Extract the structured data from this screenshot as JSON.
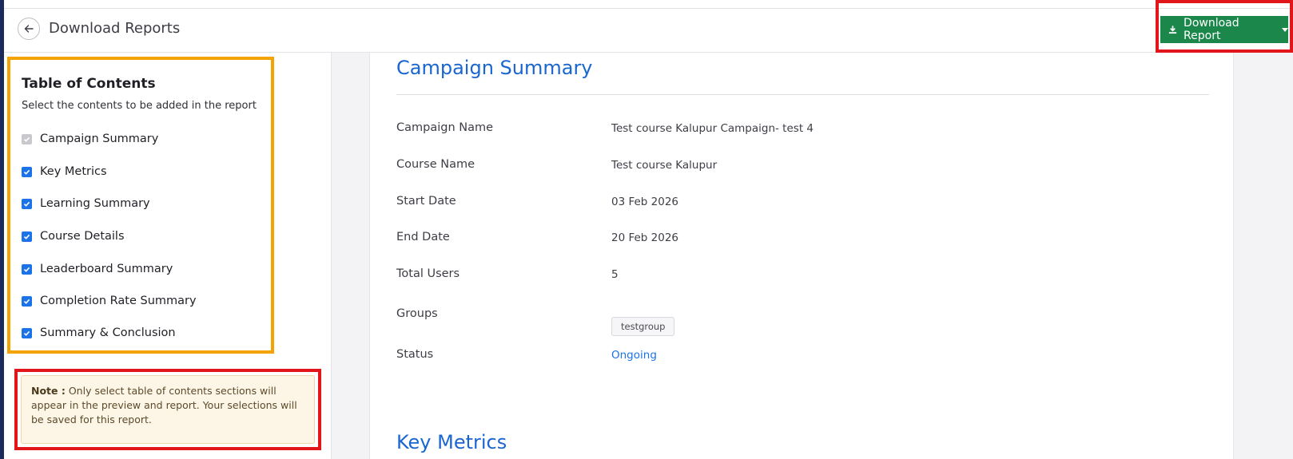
{
  "header": {
    "title": "Download Reports",
    "download_button": "Download Report"
  },
  "toc": {
    "title": "Table of Contents",
    "subtitle": "Select the contents to be added in the report",
    "items": [
      {
        "label": "Campaign Summary",
        "checked": true,
        "disabled": true
      },
      {
        "label": "Key Metrics",
        "checked": true
      },
      {
        "label": "Learning Summary",
        "checked": true
      },
      {
        "label": "Course Details",
        "checked": true
      },
      {
        "label": "Leaderboard Summary",
        "checked": true
      },
      {
        "label": "Completion Rate Summary",
        "checked": true
      },
      {
        "label": "Summary & Conclusion",
        "checked": true
      }
    ]
  },
  "note": {
    "label": "Note :",
    "text": " Only select table of contents sections will appear in the preview and report. Your selections will be saved for this report."
  },
  "summary": {
    "title": "Campaign Summary",
    "rows": [
      {
        "label": "Campaign Name",
        "value": "Test course Kalupur Campaign- test 4"
      },
      {
        "label": "Course Name",
        "value": "Test course Kalupur"
      },
      {
        "label": "Start Date",
        "value": "03 Feb 2026"
      },
      {
        "label": "End Date",
        "value": "20 Feb 2026"
      },
      {
        "label": "Total Users",
        "value": "5"
      },
      {
        "label": "Groups",
        "value": "testgroup"
      },
      {
        "label": "Status",
        "value": "Ongoing"
      }
    ],
    "next_section_title": "Key Metrics"
  },
  "colors": {
    "accent_blue": "#1a66d0",
    "download_green": "#1c874b",
    "highlight_red": "#e2151b",
    "highlight_orange": "#f5a300"
  },
  "icons": {
    "back": "arrow-left-icon",
    "download": "download-icon",
    "dropdown": "caret-down-icon",
    "check": "check-icon"
  }
}
